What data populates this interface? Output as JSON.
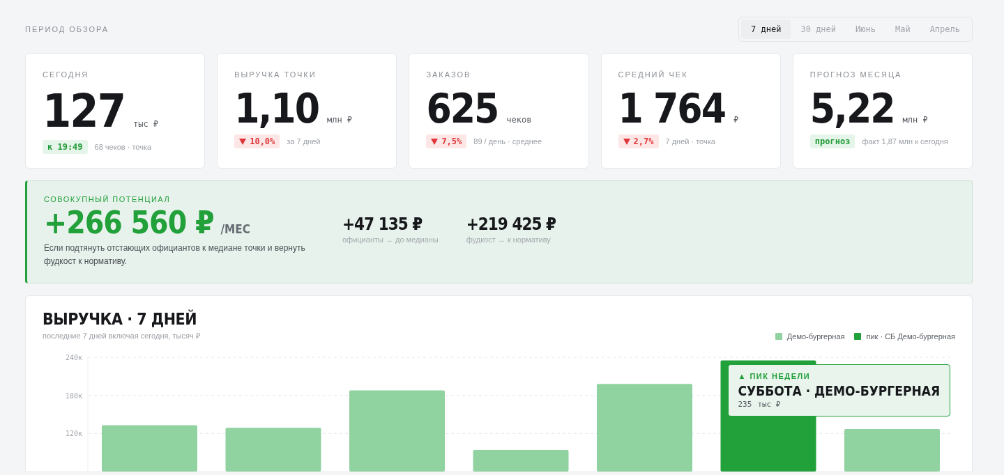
{
  "period": {
    "label": "ПЕРИОД ОБЗОРА",
    "options": [
      {
        "label": "7 дней",
        "selected": true
      },
      {
        "label": "30 дней",
        "selected": false
      },
      {
        "label": "Июнь",
        "selected": false
      },
      {
        "label": "Май",
        "selected": false
      },
      {
        "label": "Апрель",
        "selected": false
      }
    ]
  },
  "kpis": [
    {
      "title": "СЕГОДНЯ",
      "value": "127",
      "unit": "тыс ₽",
      "badge": {
        "kind": "good",
        "text": "к 19:49"
      },
      "note": "68 чеков · точка"
    },
    {
      "title": "ВЫРУЧКА ТОЧКИ",
      "value": "1,10",
      "unit": "млн ₽",
      "badge": {
        "kind": "down",
        "text": "10,0%"
      },
      "note": "за 7 дней"
    },
    {
      "title": "ЗАКАЗОВ",
      "value": "625",
      "unit": "чеков",
      "badge": {
        "kind": "down",
        "text": "7,5%"
      },
      "note": "89 / день · среднее"
    },
    {
      "title": "СРЕДНИЙ ЧЕК",
      "value": "1 764",
      "unit": "₽",
      "badge": {
        "kind": "down",
        "text": "2,7%"
      },
      "note": "7 дней · точка"
    },
    {
      "title": "ПРОГНОЗ МЕСЯЦА",
      "value": "5,22",
      "unit": "млн ₽",
      "badge": {
        "kind": "good",
        "text": "прогноз"
      },
      "note": "факт 1,87 млн к сегодня"
    }
  ],
  "potential": {
    "label": "СОВОКУПНЫЙ ПОТЕНЦИАЛ",
    "value": "+266 560 ₽",
    "unit": "/МЕС",
    "description": "Если подтянуть отстающих официантов к медиане точки и вернуть фудкост к нормативу.",
    "parts": [
      {
        "value": "+47 135 ₽",
        "caption": "официанты → до медианы"
      },
      {
        "value": "+219 425 ₽",
        "caption": "фудкост → к нормативу"
      }
    ]
  },
  "revenue": {
    "title": "ВЫРУЧКА · 7 ДНЕЙ",
    "subtitle": "последние 7 дней включая сегодня, тысяч ₽",
    "peak": {
      "kicker": "▲ ПИК НЕДЕЛИ",
      "title": "СУББОТА · ДЕМО-БУРГЕРНАЯ",
      "value": "235",
      "unit": "тыс ₽"
    },
    "chart_data": {
      "type": "bar",
      "ylim": [
        60,
        240
      ],
      "yticks": [
        {
          "value": 120,
          "label": "120к"
        },
        {
          "value": 180,
          "label": "180к"
        },
        {
          "value": 240,
          "label": "240к"
        }
      ],
      "series": [
        {
          "name": "Демо-бургерная",
          "color": "#90d2a0",
          "values": [
            133,
            129,
            188,
            94,
            198,
            null,
            127
          ]
        },
        {
          "name": "пик · СБ Демо-бургерная",
          "color": "#22a03a",
          "values": [
            null,
            null,
            null,
            null,
            null,
            235,
            null
          ]
        }
      ]
    }
  }
}
